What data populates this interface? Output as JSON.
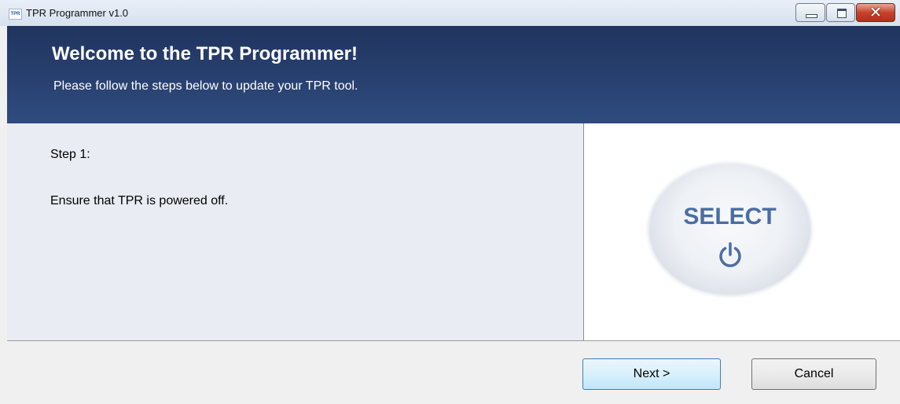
{
  "window": {
    "title": "TPR Programmer v1.0",
    "icon_name": "tpr-app-icon",
    "icon_text": "TPR"
  },
  "header": {
    "title": "Welcome to the TPR Programmer!",
    "subtitle": "Please follow the steps below to update your TPR tool."
  },
  "step": {
    "label": "Step 1:",
    "instruction": "Ensure that TPR is powered off."
  },
  "illustration": {
    "button_label": "SELECT",
    "icon_name": "power-icon",
    "accent_color": "#4a6ea3"
  },
  "buttons": {
    "next": "Next >",
    "cancel": "Cancel"
  },
  "colors": {
    "header_bg": "#2a416f",
    "content_bg": "#e9ecf3"
  }
}
